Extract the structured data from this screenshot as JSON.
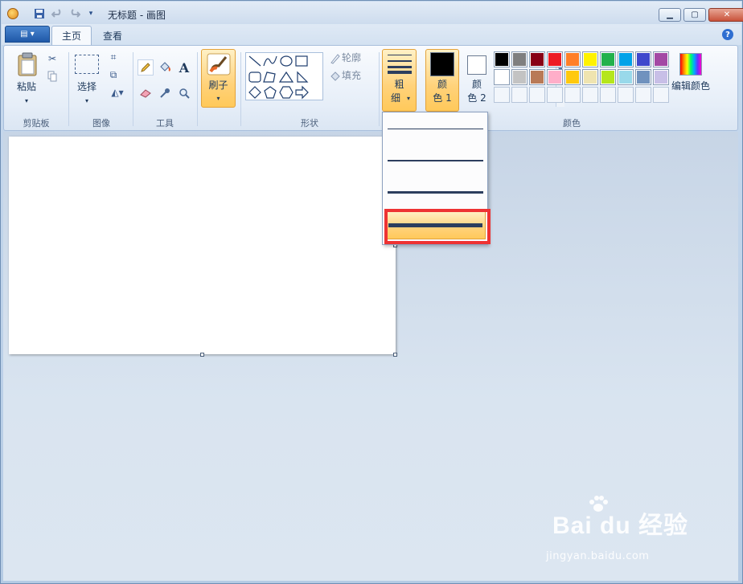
{
  "window": {
    "title": "无标题 - 画图",
    "minimize_icon": "minimize-icon",
    "maximize_icon": "maximize-icon",
    "close_icon": "close-icon"
  },
  "tabs": [
    {
      "label": "主页",
      "active": true
    },
    {
      "label": "查看",
      "active": false
    }
  ],
  "ribbon": {
    "clipboard": {
      "paste_label": "粘贴",
      "group_label": "剪贴板"
    },
    "image": {
      "select_label": "选择",
      "group_label": "图像"
    },
    "tools": {
      "group_label": "工具"
    },
    "brushes": {
      "label": "刷子"
    },
    "shapes": {
      "outline_label": "轮廓",
      "fill_label": "填充",
      "group_label": "形状"
    },
    "size": {
      "label_line1": "粗",
      "label_line2": "细"
    },
    "colors": {
      "color1_label_line1": "颜",
      "color1_label_line2": "色 1",
      "color2_label_line1": "颜",
      "color2_label_line2": "色 2",
      "edit_label": "编辑颜色",
      "group_label": "颜色",
      "color1_value": "#000000",
      "color2_value": "#ffffff",
      "palette_row1": [
        "#000000",
        "#7f7f7f",
        "#880015",
        "#ed1c24",
        "#ff7f27",
        "#fff200",
        "#22b14c",
        "#00a2e8",
        "#3f48cc",
        "#a349a4"
      ],
      "palette_row2": [
        "#ffffff",
        "#c3c3c3",
        "#b97a57",
        "#ffaec9",
        "#ffc90e",
        "#efe4b0",
        "#b5e61d",
        "#99d9ea",
        "#7092be",
        "#c8bfe7"
      ]
    }
  },
  "size_options": [
    {
      "name": "1px",
      "selected": false
    },
    {
      "name": "3px",
      "selected": false
    },
    {
      "name": "5px",
      "selected": false
    },
    {
      "name": "8px",
      "selected": true
    }
  ],
  "watermark": {
    "brand": "Bai du 经验",
    "url": "jingyan.baidu.com"
  }
}
